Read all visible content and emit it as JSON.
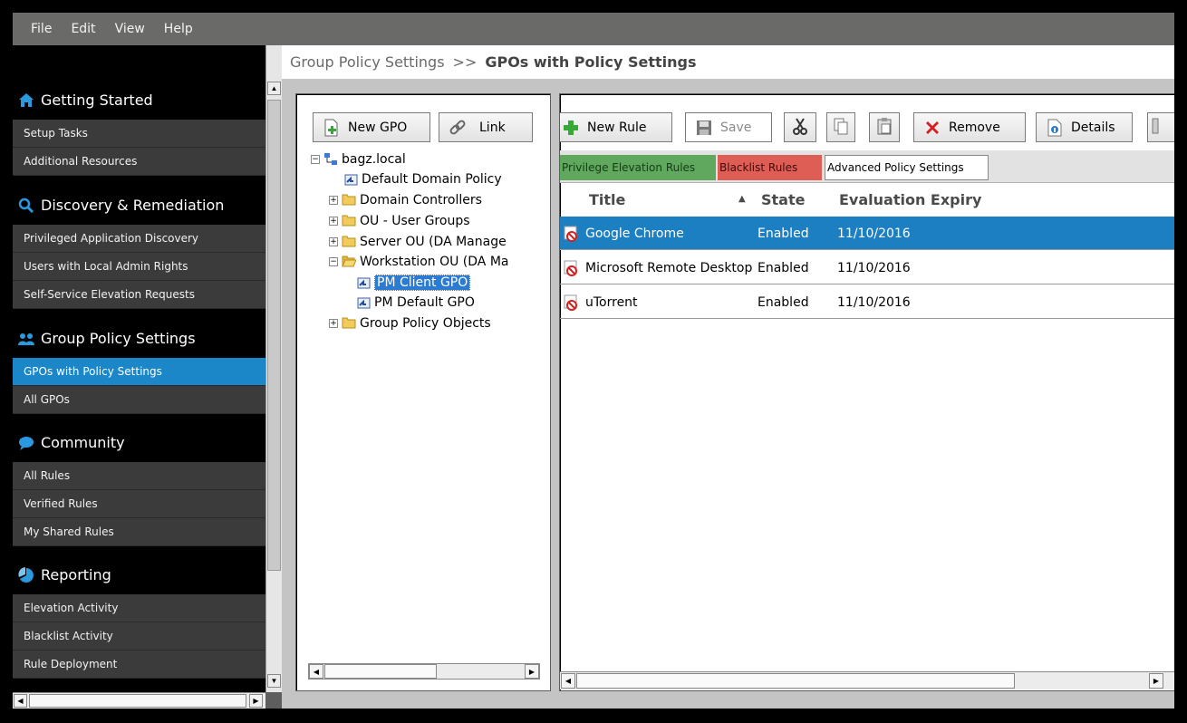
{
  "menu": {
    "file": "File",
    "edit": "Edit",
    "view": "View",
    "help": "Help"
  },
  "sidebar": {
    "getting_started": {
      "title": "Getting Started",
      "icon": "home-icon",
      "items": [
        "Setup Tasks",
        "Additional Resources"
      ]
    },
    "discovery": {
      "title": "Discovery & Remediation",
      "icon": "search-icon",
      "items": [
        "Privileged Application Discovery",
        "Users with Local Admin Rights",
        "Self-Service Elevation Requests"
      ]
    },
    "group_policy": {
      "title": "Group Policy Settings",
      "icon": "users-icon",
      "items": [
        "GPOs with Policy Settings",
        "All GPOs"
      ]
    },
    "community": {
      "title": "Community",
      "icon": "chat-icon",
      "items": [
        "All Rules",
        "Verified Rules",
        "My Shared Rules"
      ]
    },
    "reporting": {
      "title": "Reporting",
      "icon": "pie-chart-icon",
      "items": [
        "Elevation Activity",
        "Blacklist Activity",
        "Rule Deployment"
      ]
    },
    "active_item": "GPOs with Policy Settings",
    "accent_color": "#1b87c9"
  },
  "breadcrumb": {
    "parent": "Group Policy Settings",
    "separator": ">>",
    "current": "GPOs with Policy Settings"
  },
  "gpo_panel": {
    "new_gpo_label": "New GPO",
    "link_label": "Link",
    "tree": {
      "root": "bagz.local",
      "default_domain_policy": "Default Domain Policy",
      "domain_controllers": "Domain Controllers",
      "ou_user_groups": "OU - User Groups",
      "server_ou": "Server OU (DA Manage",
      "workstation_ou": "Workstation OU (DA Ma",
      "pm_client_gpo": "PM  Client GPO",
      "pm_default_gpo": "PM Default GPO",
      "group_policy_objects": "Group Policy Objects"
    },
    "selected_node": "PM  Client GPO"
  },
  "rules_panel": {
    "toolbar": {
      "new_rule": "New Rule",
      "save": "Save",
      "remove": "Remove",
      "details": "Details"
    },
    "tabs": {
      "privilege": "Privilege Elevation Rules",
      "blacklist": "Blacklist Rules",
      "advanced": "Advanced Policy Settings"
    },
    "active_tab": "Blacklist Rules",
    "columns": {
      "title": "Title",
      "state": "State",
      "expiry": "Evaluation Expiry"
    },
    "sort": {
      "column": "Title",
      "direction": "ascending"
    },
    "rows": [
      {
        "title": "Google Chrome",
        "state": "Enabled",
        "expiry": "11/10/2016",
        "selected": true
      },
      {
        "title": "Microsoft Remote Desktop",
        "state": "Enabled",
        "expiry": "11/10/2016",
        "selected": false
      },
      {
        "title": "uTorrent",
        "state": "Enabled",
        "expiry": "11/10/2016",
        "selected": false
      }
    ],
    "selection_color": "#1c7fc2"
  }
}
